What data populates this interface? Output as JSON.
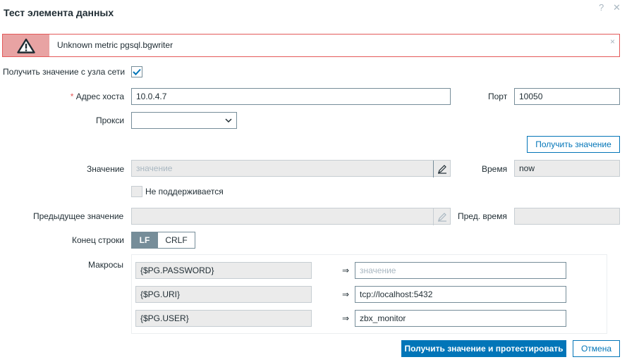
{
  "dialog": {
    "title": "Тест элемента данных",
    "help_icon": "?",
    "close_icon": "✕"
  },
  "message": {
    "text": "Unknown metric pgsql.bgwriter",
    "close": "×",
    "icon": "warning-icon"
  },
  "get_from_host": {
    "label": "Получить значение с узла сети",
    "checked": true
  },
  "host": {
    "label": "Адрес хоста",
    "required_mark": "*",
    "value": "10.0.4.7"
  },
  "port": {
    "label": "Порт",
    "value": "10050"
  },
  "proxy": {
    "label": "Прокси",
    "value": ""
  },
  "get_value_button": "Получить значение",
  "value": {
    "label": "Значение",
    "placeholder": "значение"
  },
  "time": {
    "label": "Время",
    "value": "now"
  },
  "not_supported": {
    "label": "Не поддерживается",
    "checked": false
  },
  "prev_value": {
    "label": "Предыдущее значение",
    "value": ""
  },
  "prev_time": {
    "label": "Пред. время",
    "value": ""
  },
  "eol": {
    "label": "Конец строки",
    "options": [
      "LF",
      "CRLF"
    ],
    "selected": "LF"
  },
  "macros": {
    "label": "Макросы",
    "arrow": "⇒",
    "rows": [
      {
        "name": "{$PG.PASSWORD}",
        "value": "",
        "placeholder": "значение"
      },
      {
        "name": "{$PG.URI}",
        "value": "tcp://localhost:5432",
        "placeholder": ""
      },
      {
        "name": "{$PG.USER}",
        "value": "zbx_monitor",
        "placeholder": ""
      }
    ]
  },
  "footer": {
    "test_button": "Получить значение и протестировать",
    "cancel_button": "Отмена"
  },
  "colors": {
    "accent": "#0275b8",
    "error": "#e45959",
    "error_bg": "#e8a3a3"
  }
}
